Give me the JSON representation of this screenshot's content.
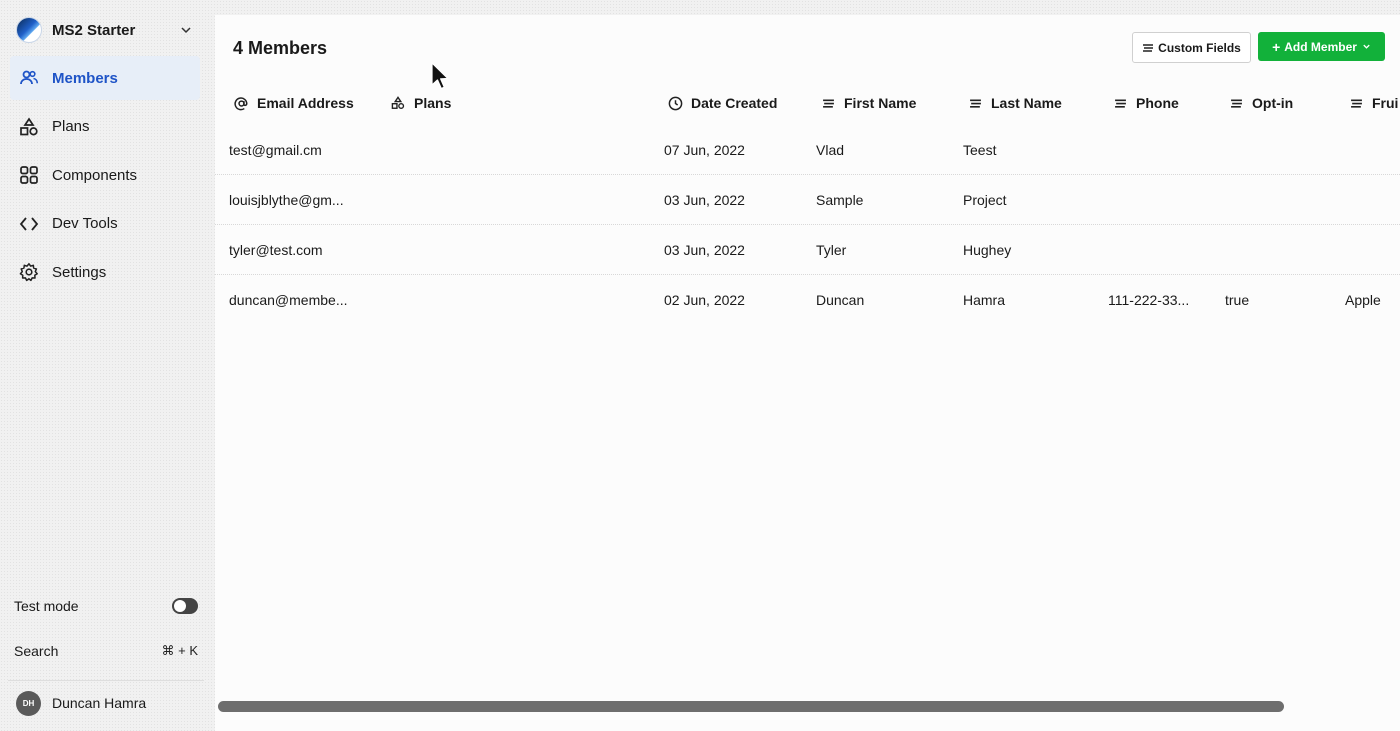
{
  "workspace": {
    "name": "MS2 Starter"
  },
  "sidebar": {
    "items": [
      {
        "label": "Members",
        "icon": "users-icon",
        "active": true
      },
      {
        "label": "Plans",
        "icon": "shapes-icon",
        "active": false
      },
      {
        "label": "Components",
        "icon": "grid-icon",
        "active": false
      },
      {
        "label": "Dev Tools",
        "icon": "code-icon",
        "active": false
      },
      {
        "label": "Settings",
        "icon": "gear-icon",
        "active": false
      }
    ],
    "test_mode_label": "Test mode",
    "search_label": "Search",
    "search_shortcut": "⌘ + K",
    "user": {
      "initials": "DH",
      "name": "Duncan Hamra"
    }
  },
  "main": {
    "title": "4 Members",
    "custom_fields_label": "Custom Fields",
    "add_member_label": "Add Member",
    "columns": [
      {
        "label": "Email Address",
        "icon": "at-icon"
      },
      {
        "label": "Plans",
        "icon": "shapes-icon"
      },
      {
        "label": "Date Created",
        "icon": "clock-icon"
      },
      {
        "label": "First Name",
        "icon": "text-lines-icon"
      },
      {
        "label": "Last Name",
        "icon": "text-lines-icon"
      },
      {
        "label": "Phone",
        "icon": "text-lines-icon"
      },
      {
        "label": "Opt-in",
        "icon": "text-lines-icon"
      },
      {
        "label": "Frui",
        "icon": "text-lines-icon"
      }
    ],
    "rows": [
      {
        "email": "test@gmail.cm",
        "plans": "",
        "date": "07 Jun, 2022",
        "first": "Vlad",
        "last": "Teest",
        "phone": "",
        "optin": "",
        "fruit": ""
      },
      {
        "email": "louisjblythe@gm...",
        "plans": "",
        "date": "03 Jun, 2022",
        "first": "Sample",
        "last": "Project",
        "phone": "",
        "optin": "",
        "fruit": ""
      },
      {
        "email": "tyler@test.com",
        "plans": "",
        "date": "03 Jun, 2022",
        "first": "Tyler",
        "last": "Hughey",
        "phone": "",
        "optin": "",
        "fruit": ""
      },
      {
        "email": "duncan@membe...",
        "plans": "",
        "date": "02 Jun, 2022",
        "first": "Duncan",
        "last": "Hamra",
        "phone": "111-222-33...",
        "optin": "true",
        "fruit": "Apple"
      }
    ]
  },
  "colors": {
    "accent_blue": "#1f54c7",
    "active_bg": "#e7eef8",
    "add_green": "#12b13a"
  }
}
